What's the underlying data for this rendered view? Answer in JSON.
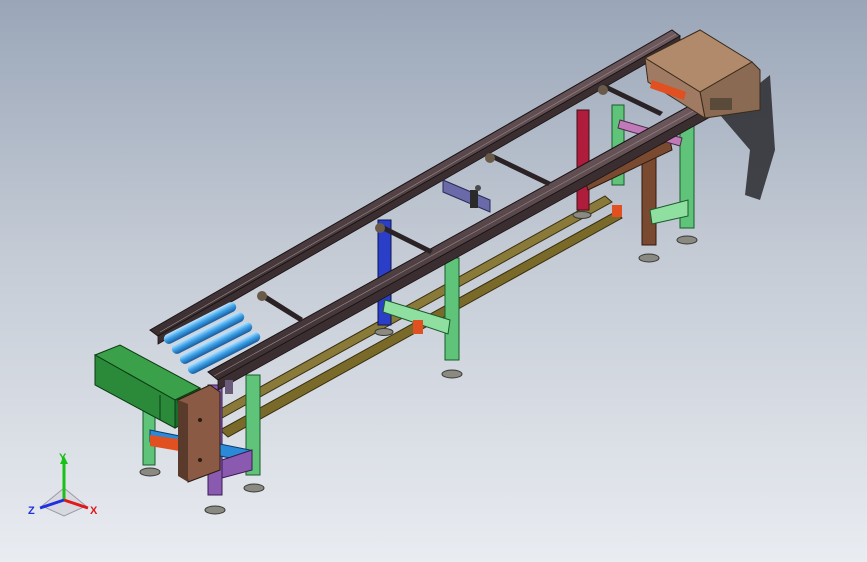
{
  "viewport": {
    "background_top": "#9aa6b8",
    "background_bottom": "#e9ecf1"
  },
  "model": {
    "subject": "conveyor-assembly",
    "colors": {
      "rail": "#4a3a3c",
      "rail_light": "#6e5a5e",
      "leg_green": "#5fc47a",
      "leg_lightgreen": "#8fe0a0",
      "leg_blue": "#2a3ec8",
      "leg_red": "#b01c3c",
      "leg_brown": "#7a4a30",
      "leg_purple": "#8a5ab0",
      "tie_bar": "#7a6a2a",
      "motor_box": "#2a8a3a",
      "end_plate": "#8a5a44",
      "roller": "#3aa0e8",
      "feet": "#8a8a82",
      "head_plate": "#a07a62",
      "accent_orange": "#e05020",
      "bracket": "#6a6aa8"
    }
  },
  "triad": {
    "x_label": "X",
    "y_label": "Y",
    "z_label": "Z",
    "x_color": "#e01818",
    "y_color": "#18c018",
    "z_color": "#2030e0"
  }
}
